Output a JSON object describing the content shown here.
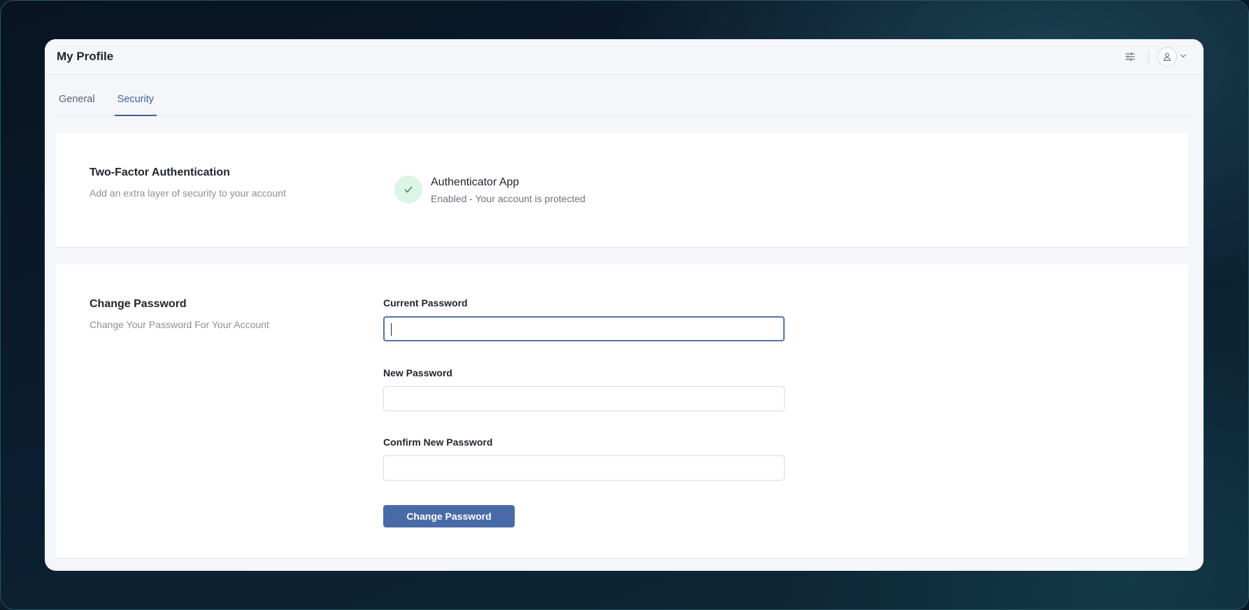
{
  "header": {
    "title": "My Profile"
  },
  "tabs": [
    {
      "label": "General",
      "active": false
    },
    {
      "label": "Security",
      "active": true
    }
  ],
  "two_factor": {
    "title": "Two-Factor Authentication",
    "description": "Add an extra layer of security to your account",
    "method_title": "Authenticator App",
    "method_status": "Enabled - Your account is protected"
  },
  "change_password": {
    "title": "Change Password",
    "description": "Change Your Password For Your Account",
    "current_label": "Current Password",
    "current_value": "",
    "new_label": "New Password",
    "new_value": "",
    "confirm_label": "Confirm New Password",
    "confirm_value": "",
    "submit_label": "Change Password"
  },
  "icons": {
    "filter": "sliders-icon",
    "avatar": "user-icon",
    "dropdown": "chevron-down-icon",
    "status": "check-icon"
  },
  "colors": {
    "accent": "#3f5f9a",
    "button": "#4b6aa8",
    "success_bg": "#dcf5e6",
    "success": "#4a8a63"
  }
}
